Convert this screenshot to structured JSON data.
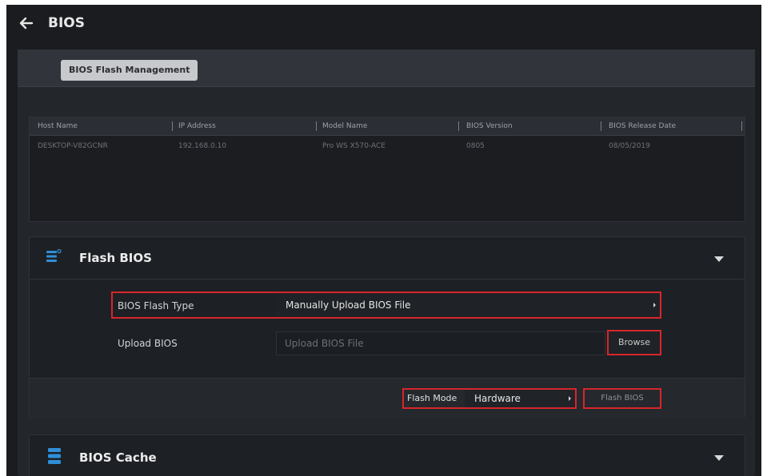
{
  "header": {
    "title": "BIOS",
    "back_icon": "arrow-left-icon"
  },
  "tabs": [
    {
      "label": "BIOS Flash Management",
      "active": true
    }
  ],
  "table": {
    "columns": [
      "Host Name",
      "IP Address",
      "Model Name",
      "BIOS Version",
      "BIOS Release Date"
    ],
    "rows": [
      [
        "DESKTOP-V82GCNR",
        "192.168.0.10",
        "Pro WS X570-ACE",
        "0805",
        "08/05/2019"
      ]
    ]
  },
  "flash_bios": {
    "title": "Flash BIOS",
    "icon": "list-settings-icon",
    "flash_type_label": "BIOS Flash Type",
    "flash_type_value": "Manually Upload BIOS File",
    "upload_label": "Upload BIOS",
    "upload_placeholder": "Upload BIOS File",
    "browse_label": "Browse",
    "flash_mode_label": "Flash Mode",
    "flash_mode_value": "Hardware",
    "flash_button_label": "Flash BIOS"
  },
  "bios_cache": {
    "title": "BIOS Cache",
    "icon": "database-icon"
  },
  "colors": {
    "background": "#1a1c20",
    "panel": "#23262b",
    "highlight_outline": "#d7262c",
    "accent_icon": "#2f8fd8",
    "tab_active_bg": "#c7c9cc"
  }
}
